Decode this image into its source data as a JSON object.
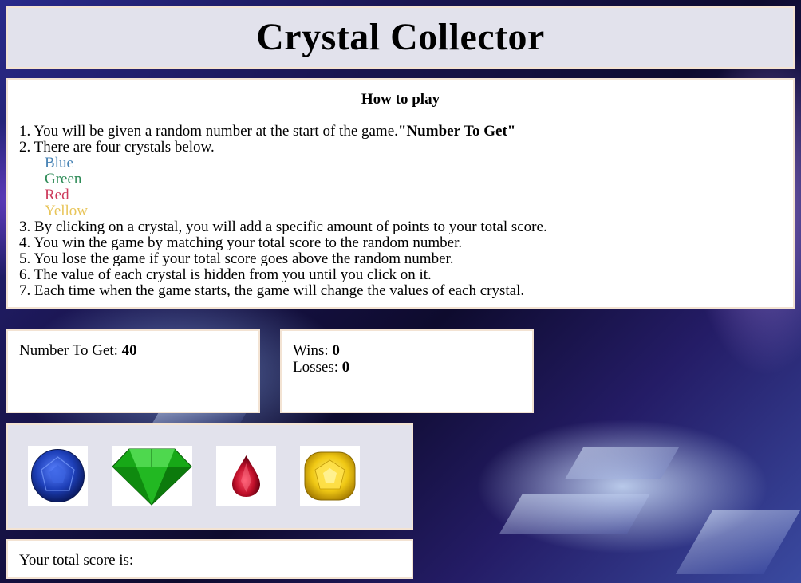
{
  "title": "Crystal Collector",
  "howto": {
    "heading": "How to play",
    "step1": "1. You will be given a random number at the start of the game.",
    "step1_bold": "\"Number To Get\"",
    "step2": "2. There are four crystals below.",
    "colors": [
      {
        "name": "Blue",
        "color": "#4682b4"
      },
      {
        "name": "Green",
        "color": "#2e8b57"
      },
      {
        "name": "Red",
        "color": "#cd3b5c"
      },
      {
        "name": "Yellow",
        "color": "#e8c55a"
      }
    ],
    "step3": "3. By clicking on a crystal, you will add a specific amount of points to your total score.",
    "step4": "4. You win the game by matching your total score to the random number.",
    "step5": "5. You lose the game if your total score goes above the random number.",
    "step6": "6. The value of each crystal is hidden from you until you click on it.",
    "step7": "7. Each time when the game starts, the game will change the values of each crystal."
  },
  "target": {
    "label": "Number To Get: ",
    "value": "40"
  },
  "stats": {
    "wins_label": "Wins: ",
    "wins": "0",
    "losses_label": "Losses: ",
    "losses": "0"
  },
  "crystals": [
    {
      "name": "blue-crystal",
      "color": "#1d3fb8"
    },
    {
      "name": "green-crystal",
      "color": "#1aa31a"
    },
    {
      "name": "red-crystal",
      "color": "#c0102a"
    },
    {
      "name": "yellow-crystal",
      "color": "#f0c814"
    }
  ],
  "score": {
    "label": "Your total score is:",
    "value": ""
  }
}
